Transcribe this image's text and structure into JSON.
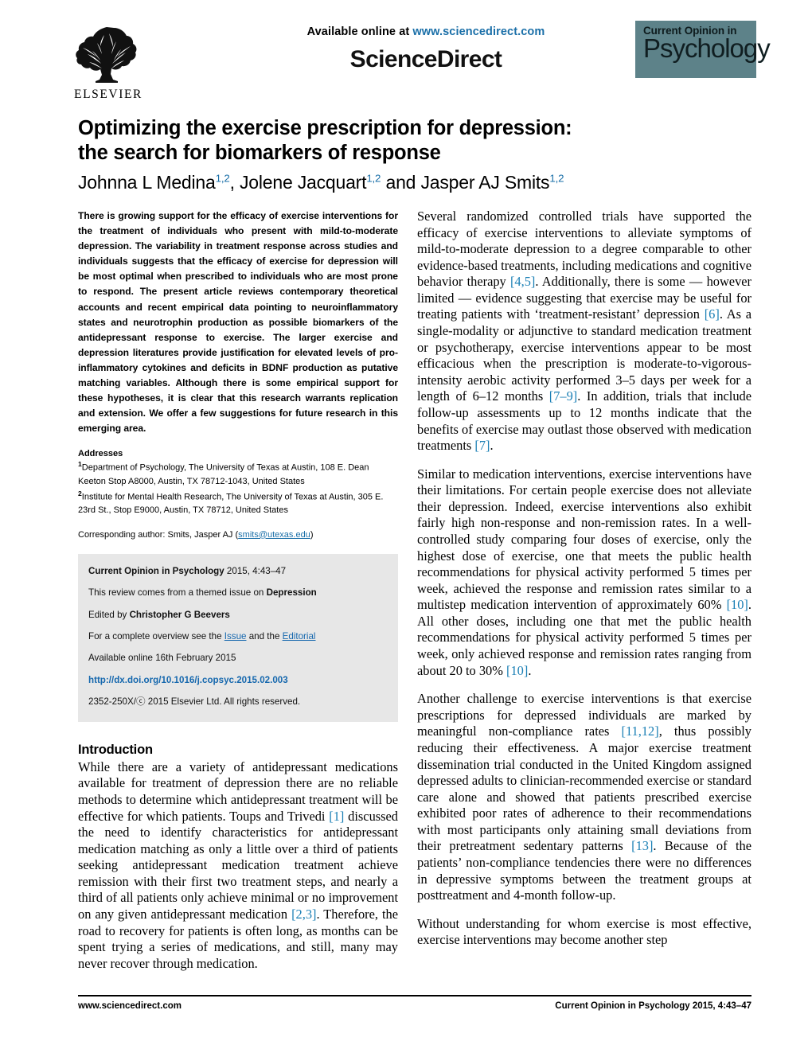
{
  "header": {
    "publisher_name": "ELSEVIER",
    "available_line_prefix": "Available online at ",
    "available_url": "www.sciencedirect.com",
    "sciencedirect_wordmark": "ScienceDirect",
    "journal_logo_line1": "Current Opinion in",
    "journal_logo_line2": "Psychology",
    "journal_logo_color": "#5d8289"
  },
  "article": {
    "title": "Optimizing the exercise prescription for depression: the search for biomarkers of response",
    "title_line1": "Optimizing the exercise prescription for depression:",
    "title_line2": "the search for biomarkers of response",
    "authors_plain": "Johnna L Medina, Jolene Jacquart and Jasper AJ Smits",
    "author1": "Johnna L Medina",
    "author1_sup": "1,2",
    "author2": "Jolene Jacquart",
    "author2_sup": "1,2",
    "author_conjunction": "and",
    "author3": "Jasper AJ Smits",
    "author3_sup": "1,2"
  },
  "abstract": {
    "text": "There is growing support for the efficacy of exercise interventions for the treatment of individuals who present with mild-to-moderate depression. The variability in treatment response across studies and individuals suggests that the efficacy of exercise for depression will be most optimal when prescribed to individuals who are most prone to respond. The present article reviews contemporary theoretical accounts and recent empirical data pointing to neuroinflammatory states and neurotrophin production as possible biomarkers of the antidepressant response to exercise. The larger exercise and depression literatures provide justification for elevated levels of pro-inflammatory cytokines and deficits in BDNF production as putative matching variables. Although there is some empirical support for these hypotheses, it is clear that this research warrants replication and extension. We offer a few suggestions for future research in this emerging area."
  },
  "addresses": {
    "heading": "Addresses",
    "aff1_sup": "1",
    "aff1": "Department of Psychology, The University of Texas at Austin, 108 E. Dean Keeton Stop A8000, Austin, TX 78712-1043, United States",
    "aff2_sup": "2",
    "aff2": "Institute for Mental Health Research, The University of Texas at Austin, 305 E. 23rd St., Stop E9000, Austin, TX 78712, United States",
    "corresponding_prefix": "Corresponding author: Smits, Jasper AJ (",
    "corresponding_email": "smits@utexas.edu",
    "corresponding_suffix": ")"
  },
  "citation_box": {
    "journal_name": "Current Opinion in Psychology",
    "citation_rest": " 2015, 4:43–47",
    "themed_prefix": "This review comes from a themed issue on ",
    "themed_topic": "Depression",
    "edited_prefix": "Edited by ",
    "editor": "Christopher G Beevers",
    "overview_prefix": "For a complete overview see the ",
    "overview_link1": "Issue",
    "overview_mid": " and the ",
    "overview_link2": "Editorial",
    "available_online": "Available online 16th February 2015",
    "doi": "http://dx.doi.org/10.1016/j.copsyc.2015.02.003",
    "copyright": "2352-250X/ⓒ 2015 Elsevier Ltd. All rights reserved."
  },
  "introduction": {
    "heading": "Introduction",
    "paragraph1_a": "While there are a variety of antidepressant medications available for treatment of depression there are no reliable methods to determine which antidepressant treatment will be effective for which patients. Toups and Trivedi ",
    "ref1": "[1]",
    "paragraph1_b": " discussed the need to identify characteristics for antidepressant medication matching as only a little over a third of patients seeking antidepressant medication treatment achieve remission with their first two treatment steps, and nearly a third of all patients only achieve minimal or no improvement on any given antidepressant medication ",
    "ref2": "[2,3]",
    "paragraph1_c": ". Therefore, the road to recovery for patients is often long, as months can be spent trying a series of medications, and still, many may never recover through medication."
  },
  "right_column": {
    "p1_a": "Several randomized controlled trials have supported the efficacy of exercise interventions to alleviate symptoms of mild-to-moderate depression to a degree comparable to other evidence-based treatments, including medications and cognitive behavior therapy ",
    "p1_ref1": "[4,5]",
    "p1_b": ". Additionally, there is some — however limited — evidence suggesting that exercise may be useful for treating patients with ‘treatment-resistant’ depression ",
    "p1_ref2": "[6]",
    "p1_c": ". As a single-modality or adjunctive to standard medication treatment or psychotherapy, exercise interventions appear to be most efficacious when the prescription is moderate-to-vigorous-intensity aerobic activity performed 3–5 days per week for a length of 6–12 months ",
    "p1_ref3": "[7–9]",
    "p1_d": ". In addition, trials that include follow-up assessments up to 12 months indicate that the benefits of exercise may outlast those observed with medication treatments ",
    "p1_ref4": "[7]",
    "p1_e": ".",
    "p2_a": "Similar to medication interventions, exercise interventions have their limitations. For certain people exercise does not alleviate their depression. Indeed, exercise interventions also exhibit fairly high non-response and non-remission rates. In a well-controlled study comparing four doses of exercise, only the highest dose of exercise, one that meets the public health recommendations for physical activity performed 5 times per week, achieved the response and remission rates similar to a multistep medication intervention of approximately 60% ",
    "p2_ref1": "[10]",
    "p2_b": ". All other doses, including one that met the public health recommendations for physical activity performed 5 times per week, only achieved response and remission rates ranging from about 20 to 30% ",
    "p2_ref2": "[10]",
    "p2_c": ".",
    "p3_a": "Another challenge to exercise interventions is that exercise prescriptions for depressed individuals are marked by meaningful non-compliance rates ",
    "p3_ref1": "[11,12]",
    "p3_b": ", thus possibly reducing their effectiveness. A major exercise treatment dissemination trial conducted in the United Kingdom assigned depressed adults to clinician-recommended exercise or standard care alone and showed that patients prescribed exercise exhibited poor rates of adherence to their recommendations with most participants only attaining small deviations from their pretreatment sedentary patterns ",
    "p3_ref2": "[13]",
    "p3_c": ". Because of the patients’ non-compliance tendencies there were no differences in depressive symptoms between the treatment groups at posttreatment and 4-month follow-up.",
    "p4": "Without understanding for whom exercise is most effective, exercise interventions may become another step"
  },
  "footer": {
    "left": "www.sciencedirect.com",
    "right_bold": "Current Opinion in Psychology",
    "right_rest": " 2015, 4:43–47"
  }
}
